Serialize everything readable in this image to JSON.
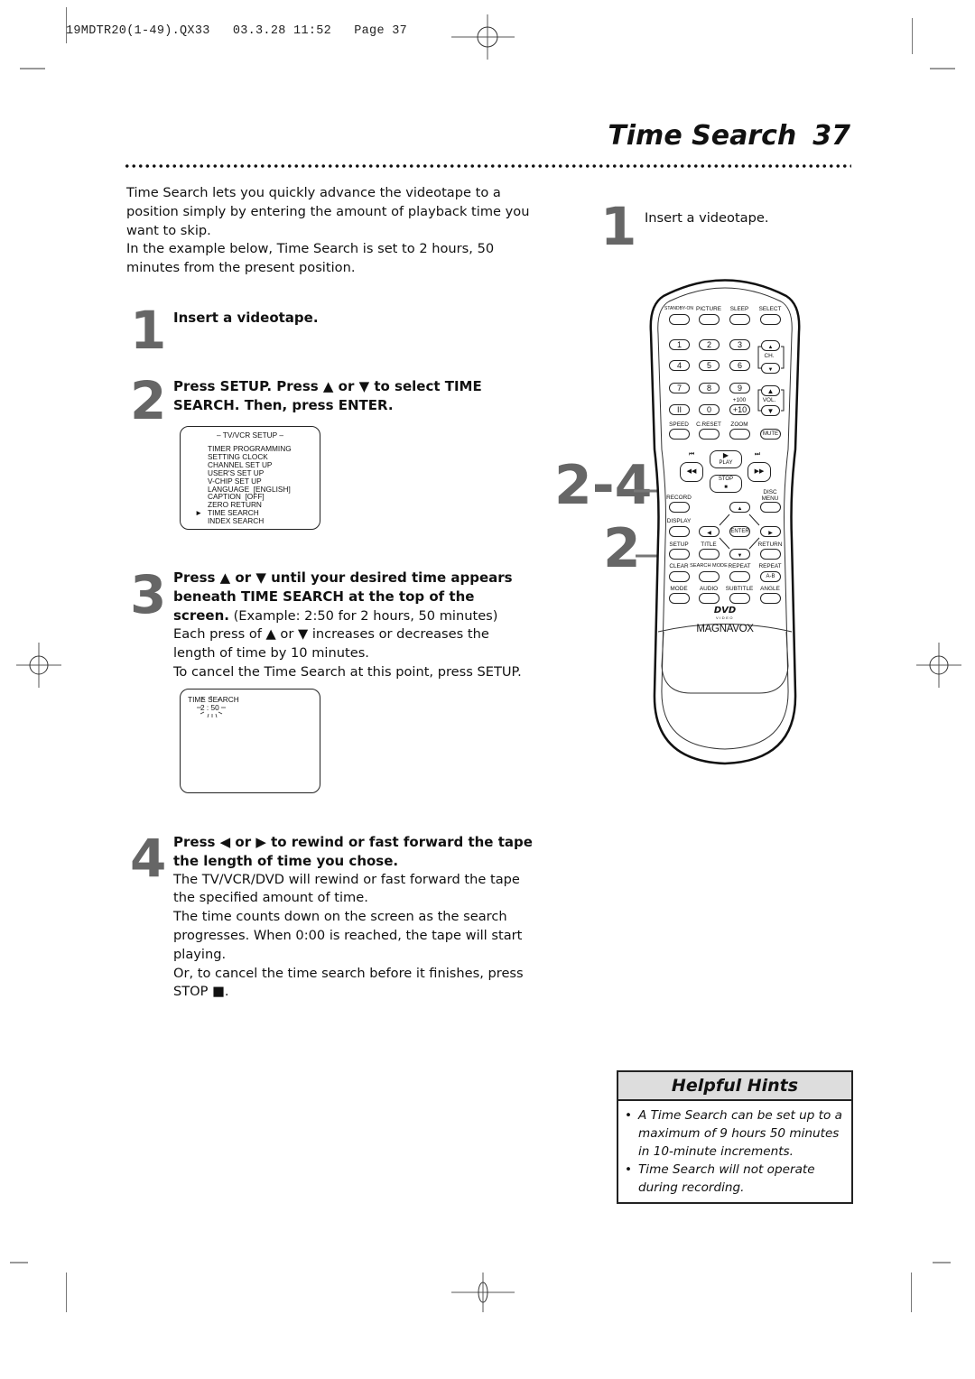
{
  "slug_line": "19MDTR20(1-49).QX33   03.3.28 11:52   Page 37",
  "page_title": "Time Search",
  "page_number": "37",
  "intro": {
    "paragraph_1": "Time Search lets you quickly advance the videotape to a position simply by entering the amount of playback time you want to skip.",
    "paragraph_2": "In the example below, Time Search is set to 2 hours, 50 minutes from the present position."
  },
  "steps": [
    {
      "number": "1",
      "title": "Insert a videotape."
    },
    {
      "number": "2",
      "title": "Press SETUP. Press ▲ or ▼ to select TIME SEARCH. Then, press ENTER."
    },
    {
      "number": "3",
      "title": "Press ▲ or ▼ until your desired time appears beneath TIME SEARCH at the top of the screen.",
      "example": " (Example: 2:50 for 2 hours, 50 minutes)",
      "body": [
        "Each press of ▲ or ▼ increases or decreases the length of time by 10 minutes.",
        "To cancel the Time Search at this point, press SETUP."
      ]
    },
    {
      "number": "4",
      "title": "Press ◀ or ▶ to rewind or fast forward the tape the length of time you chose.",
      "body": [
        "The TV/VCR/DVD will rewind or fast forward the tape the specified amount of time.",
        "The time counts down on the screen as the search progresses. When 0:00 is reached, the tape will start playing.",
        "Or, to cancel the time search before it finishes, press STOP ■."
      ]
    }
  ],
  "setup_menu_screen": {
    "header": "– TV/VCR SETUP –",
    "items": [
      "TIMER PROGRAMMING",
      "SETTING CLOCK",
      "CHANNEL SET UP",
      "USER'S SET UP",
      "V-CHIP SET UP",
      "LANGUAGE  [ENGLISH]",
      "CAPTION  [OFF]",
      "ZERO RETURN",
      "TIME SEARCH",
      "INDEX SEARCH"
    ],
    "selected_index": 8,
    "cursor_glyph": "►"
  },
  "time_search_screen": {
    "label": "TIME SEARCH",
    "value": "2 : 50"
  },
  "right_column": {
    "step_number": "1",
    "step_text": "Insert a videotape."
  },
  "callouts": [
    {
      "label": "2-4"
    },
    {
      "label": "2"
    }
  ],
  "remote": {
    "top_labels": [
      "STANDBY-ON",
      "PICTURE",
      "SLEEP",
      "SELECT"
    ],
    "number_keys": [
      "1",
      "2",
      "3",
      "4",
      "5",
      "6",
      "7",
      "8",
      "9",
      "II",
      "0",
      "+10"
    ],
    "plus100_label": "+100",
    "ch_label": "CH.",
    "vol_label": "VOL.",
    "row_labels": [
      "SPEED",
      "C.RESET",
      "ZOOM"
    ],
    "mute_label": "MUTE",
    "play_label": "PLAY",
    "stop_label": "STOP",
    "record_label": "RECORD",
    "disc_menu_label": "DISC MENU",
    "display_label": "DISPLAY",
    "enter_label": "ENTER",
    "setup_label": "SETUP",
    "title_label": "TITLE",
    "return_label": "RETURN",
    "row2_labels": [
      "CLEAR",
      "SEARCH MODE",
      "REPEAT",
      "REPEAT"
    ],
    "ab_label": "A-B",
    "row3_labels": [
      "MODE",
      "AUDIO",
      "SUBTITLE",
      "ANGLE"
    ],
    "dvd_logo": "DVD",
    "dvd_sub": "VIDEO",
    "brand": "MAGNAVOX"
  },
  "helpful_hints": {
    "title": "Helpful Hints",
    "items": [
      "A Time Search can be set up to a maximum of 9 hours 50 minutes in 10-minute increments.",
      "Time Search will not operate during recording."
    ]
  }
}
